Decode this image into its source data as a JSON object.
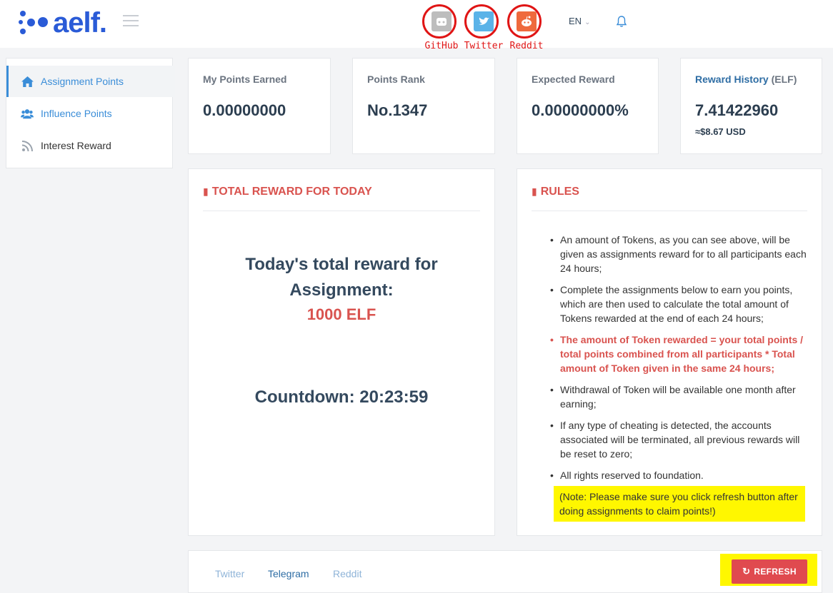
{
  "brand": {
    "name": "aelf."
  },
  "header": {
    "social": [
      {
        "label": "GitHub",
        "icon": "github-icon",
        "color": "#bdbdbd"
      },
      {
        "label": "Twitter",
        "icon": "twitter-icon",
        "color": "#5bb3e8"
      },
      {
        "label": "Reddit",
        "icon": "reddit-icon",
        "color": "#ef6a3d"
      }
    ],
    "language": "EN"
  },
  "sidebar": {
    "items": [
      {
        "label": "Assignment Points",
        "icon": "home-icon",
        "active": true
      },
      {
        "label": "Influence Points",
        "icon": "users-icon",
        "active": false
      },
      {
        "label": "Interest Reward",
        "icon": "rss-icon",
        "active": false
      }
    ]
  },
  "stats": {
    "points_earned": {
      "label": "My Points Earned",
      "value": "0.00000000"
    },
    "points_rank": {
      "label": "Points Rank",
      "value": "No.1347"
    },
    "expected_reward": {
      "label": "Expected Reward",
      "value": "0.00000000%"
    },
    "reward_history": {
      "label_link": "Reward History",
      "label_unit": "(ELF)",
      "value": "7.41422960",
      "usd": "≈$8.67 USD"
    }
  },
  "total_reward": {
    "title": "TOTAL REWARD FOR TODAY",
    "line1": "Today's total reward for",
    "line2": "Assignment:",
    "amount": "1000 ELF",
    "countdown_label": "Countdown:",
    "countdown": "20:23:59"
  },
  "rules": {
    "title": "RULES",
    "items": [
      "An amount of Tokens, as you can see above, will be given as assignments reward for to all participants each 24 hours;",
      "Complete the assignments below to earn you points, which are then used to calculate the total amount of Tokens rewarded at the end of each 24 hours;",
      "The amount of Token rewarded = your total points / total points combined from all participants * Total amount of Token given in the same 24 hours;",
      "Withdrawal of Token will be available one month after earning;",
      "If any type of cheating is detected, the accounts associated will be terminated, all previous rewards will be reset to zero;",
      "All rights reserved to foundation."
    ],
    "note": "(Note: Please make sure you click refresh button after doing assignments to claim points!)"
  },
  "tabs": [
    {
      "label": "Twitter",
      "active": false
    },
    {
      "label": "Telegram",
      "active": true
    },
    {
      "label": "Reddit",
      "active": false
    }
  ],
  "refresh_label": "REFRESH",
  "colors": {
    "accent": "#3a8dd8",
    "danger": "#d9534f",
    "highlight": "#fff700",
    "annotation": "#e01515"
  }
}
